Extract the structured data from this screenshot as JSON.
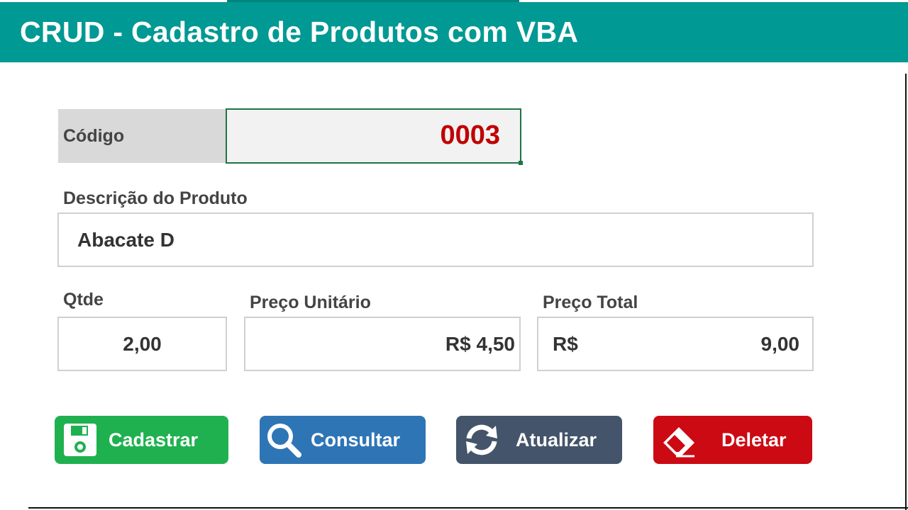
{
  "header": {
    "title": "CRUD - Cadastro de Produtos com VBA"
  },
  "form": {
    "codigo_label": "Código",
    "codigo_value": "0003",
    "descricao_label": "Descrição do Produto",
    "descricao_value": "Abacate D",
    "qtde_label": "Qtde",
    "qtde_value": "2,00",
    "preco_unitario_label": "Preço Unitário",
    "preco_unitario_value": "R$ 4,50",
    "preco_total_label": "Preço Total",
    "preco_total_currency": "R$",
    "preco_total_value": "9,00"
  },
  "buttons": {
    "cadastrar": {
      "label": "Cadastrar",
      "icon": "floppy-disk-icon",
      "color": "#1fb14f"
    },
    "consultar": {
      "label": "Consultar",
      "icon": "magnifier-icon",
      "color": "#2e75b6"
    },
    "atualizar": {
      "label": "Atualizar",
      "icon": "refresh-icon",
      "color": "#44546a"
    },
    "deletar": {
      "label": "Deletar",
      "icon": "eraser-icon",
      "color": "#cc0a14"
    }
  },
  "colors": {
    "header_bg": "#009993",
    "codigo_value_color": "#c00000",
    "selection_border": "#217346"
  }
}
